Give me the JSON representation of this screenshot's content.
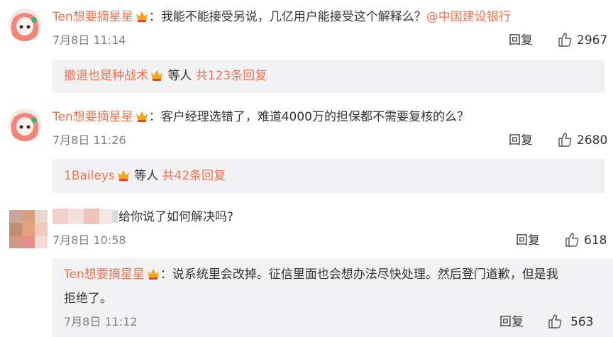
{
  "comments": [
    {
      "user": "Ten想要摘星星",
      "sep": "：",
      "text": "我能不能接受另说，几亿用户能接受这个解释么？",
      "mention": "@中国建设银行",
      "time": "7月8日 11:14",
      "reply_label": "回复",
      "likes": "2967",
      "sub": {
        "user": "撤退也是种战术",
        "suffix": " 等人 ",
        "count_text": "共123条回复"
      }
    },
    {
      "user": "Ten想要摘星星",
      "sep": "：",
      "text": "客户经理选错了，难道4000万的担保都不需要复核的么？",
      "time": "7月8日 11:26",
      "reply_label": "回复",
      "likes": "2680",
      "sub": {
        "user": "1Baileys",
        "suffix": " 等人 ",
        "count_text": "共42条回复"
      }
    },
    {
      "text": "给你说了如何解决吗?",
      "time": "7月8日 10:58",
      "reply_label": "回复",
      "likes": "618",
      "sub_reply": {
        "user": "Ten想要摘星星",
        "sep": "：",
        "line1": "说系统里会改掉。征信里面也会想办法尽快处理。然后登门道歉，但是我",
        "line2": "拒绝了。",
        "time": "7月8日 11:12",
        "reply_label": "回复",
        "likes": "563"
      }
    }
  ],
  "colors": {
    "accent": "#eb7350",
    "panel": "#f2f2f5",
    "text": "#333333",
    "muted": "#808080"
  },
  "icons": {
    "like": "thumbs-up-icon",
    "badge": "vip-crown-icon"
  }
}
